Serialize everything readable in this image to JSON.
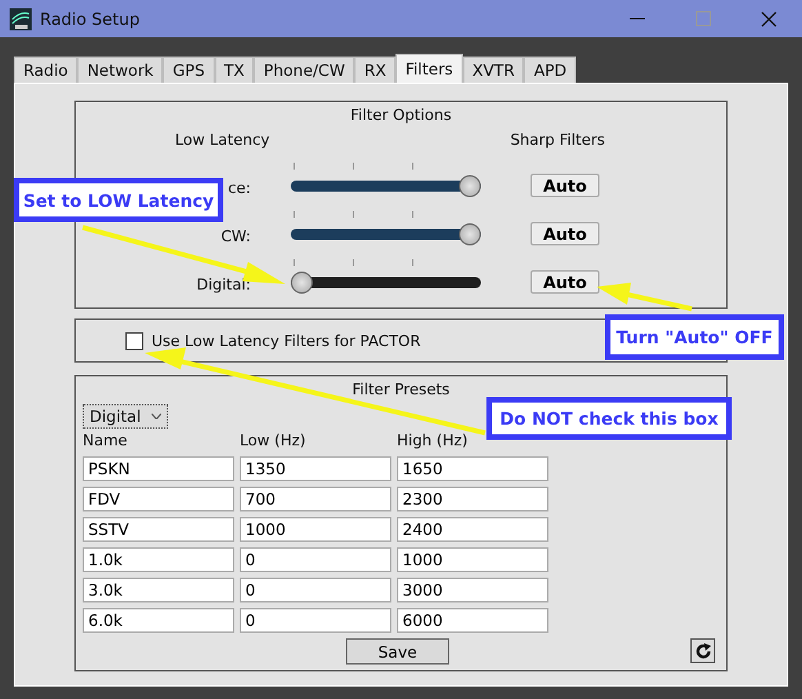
{
  "window": {
    "title": "Radio Setup"
  },
  "tabs": [
    {
      "label": "Radio",
      "selected": false
    },
    {
      "label": "Network",
      "selected": false
    },
    {
      "label": "GPS",
      "selected": false
    },
    {
      "label": "TX",
      "selected": false
    },
    {
      "label": "Phone/CW",
      "selected": false
    },
    {
      "label": "RX",
      "selected": false
    },
    {
      "label": "Filters",
      "selected": true
    },
    {
      "label": "XVTR",
      "selected": false
    },
    {
      "label": "APD",
      "selected": false
    }
  ],
  "filter_options": {
    "title": "Filter Options",
    "left_heading": "Low Latency",
    "right_heading": "Sharp Filters",
    "rows": [
      {
        "label": "ce:",
        "level": 1,
        "button": "Auto"
      },
      {
        "label": "CW:",
        "level": 1,
        "button": "Auto"
      },
      {
        "label": "Digital:",
        "level": 0,
        "button": "Auto"
      }
    ]
  },
  "pactor": {
    "label": "Use Low Latency Filters for PACTOR",
    "checked": false
  },
  "filter_presets": {
    "title": "Filter Presets",
    "mode": "Digital",
    "columns": [
      "Name",
      "Low (Hz)",
      "High (Hz)"
    ],
    "rows": [
      [
        "PSKN",
        "1350",
        "1650"
      ],
      [
        "FDV",
        "700",
        "2300"
      ],
      [
        "SSTV",
        "1000",
        "2400"
      ],
      [
        "1.0k",
        "0",
        "1000"
      ],
      [
        "3.0k",
        "0",
        "3000"
      ],
      [
        "6.0k",
        "0",
        "6000"
      ]
    ],
    "save": "Save"
  },
  "callouts": [
    "Set to LOW Latency",
    "Turn \"Auto\" OFF",
    "Do NOT check this box"
  ]
}
